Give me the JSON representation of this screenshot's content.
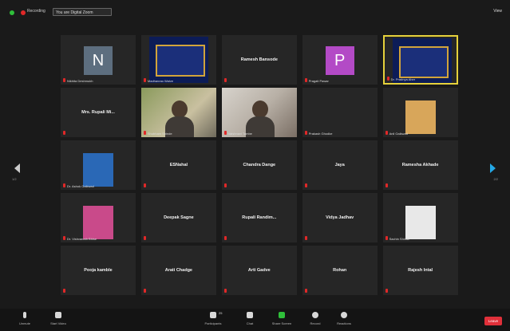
{
  "topbar": {
    "recording_label": "Recording",
    "chip_label": "You are Digital Zoom",
    "right_label": "View"
  },
  "tiles": [
    {
      "type": "letter",
      "letter": "N",
      "letter_color": "#5d6e7f",
      "label": "Nikhita Deshmukh"
    },
    {
      "type": "screen",
      "label": "Madhavrao Walve"
    },
    {
      "type": "name",
      "name": "Ramesh Bansode",
      "label": ""
    },
    {
      "type": "letter",
      "letter": "P",
      "letter_color": "#b34ac6",
      "label": "Pragati Pawar"
    },
    {
      "type": "screen",
      "label": "Dr. Pradnya Aher",
      "active": true
    },
    {
      "type": "name",
      "name": "Mrs. Rupali Mi...",
      "label": ""
    },
    {
      "type": "video",
      "label": "Shubham Shinde"
    },
    {
      "type": "video2",
      "label": "Vaishnavi Tambe"
    },
    {
      "type": "blank",
      "label": "Prakash Ghodke"
    },
    {
      "type": "photo",
      "photo_color": "#d8a65a",
      "label": "Anil Gaikwad"
    },
    {
      "type": "photo",
      "photo_color": "#2a68b6",
      "label": "Dr. Ashok Gaikwad"
    },
    {
      "type": "name",
      "name": "ESNahal",
      "label": ""
    },
    {
      "type": "name",
      "name": "Chandra Dange",
      "label": ""
    },
    {
      "type": "name",
      "name": "Jaya",
      "label": ""
    },
    {
      "type": "name",
      "name": "Ramesha Akhade",
      "label": ""
    },
    {
      "type": "photo",
      "photo_color": "#c94a8a",
      "label": "Dr. Vishvanath Bhise"
    },
    {
      "type": "name",
      "name": "Deepak Sagne",
      "label": ""
    },
    {
      "type": "name",
      "name": "Rupali Randim...",
      "label": ""
    },
    {
      "type": "name",
      "name": "Vidya Jadhav",
      "label": ""
    },
    {
      "type": "photo",
      "photo_color": "#e8e8e8",
      "label": "Sachin Shinde"
    },
    {
      "type": "name",
      "name": "Pooja kamble",
      "label": ""
    },
    {
      "type": "name",
      "name": "Arati Chadge",
      "label": ""
    },
    {
      "type": "name",
      "name": "Arti Gadve",
      "label": ""
    },
    {
      "type": "name",
      "name": "Rohan",
      "label": ""
    },
    {
      "type": "name",
      "name": "Rajesh Intal",
      "label": ""
    }
  ],
  "nav": {
    "left_page": "1/2",
    "right_page": "2/2"
  },
  "bottombar": {
    "unmute": "Unmute",
    "start_video": "Start Video",
    "participants": "Participants",
    "participants_count": "25",
    "chat": "Chat",
    "share_screen": "Share Screen",
    "record": "Record",
    "reactions": "Reactions",
    "end": "Leave"
  }
}
